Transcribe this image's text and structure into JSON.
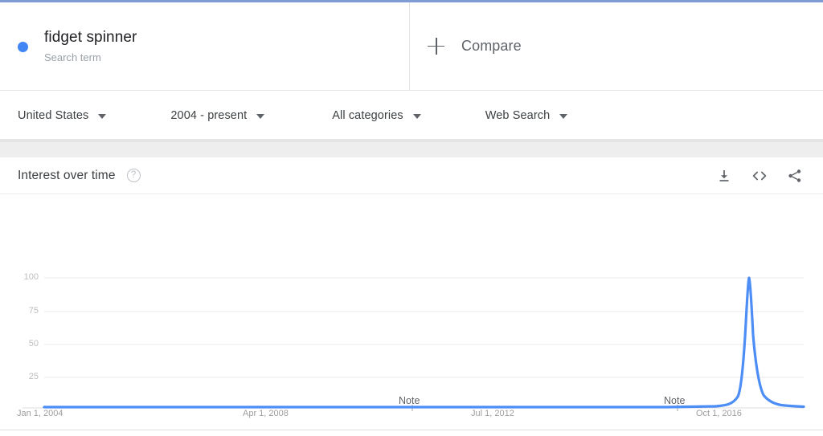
{
  "theme": {
    "accent_blue": "#4285f4",
    "top_border": "#7e9bd4",
    "line_color": "#4c8df6",
    "gridline": "#e8e8e8",
    "text_primary": "#3c4043",
    "text_muted": "#9aa0a6",
    "band_gray": "#eeeeee"
  },
  "search_term": {
    "title": "fidget spinner",
    "subtitle": "Search term"
  },
  "compare": {
    "label": "Compare",
    "icon": "plus-icon"
  },
  "filters": [
    {
      "label": "United States",
      "icon": "chevron-down-icon"
    },
    {
      "label": "2004 - present",
      "icon": "chevron-down-icon"
    },
    {
      "label": "All categories",
      "icon": "chevron-down-icon"
    },
    {
      "label": "Web Search",
      "icon": "chevron-down-icon"
    }
  ],
  "chart_card": {
    "title": "Interest over time",
    "help_glyph": "?",
    "help_icon": "help-circle-icon",
    "actions": [
      {
        "name": "download-icon",
        "label": "Download"
      },
      {
        "name": "embed-code-icon",
        "label": "Embed"
      },
      {
        "name": "share-icon",
        "label": "Share"
      }
    ]
  },
  "chart_data": {
    "type": "line",
    "title": "Interest over time",
    "xlabel": "",
    "ylabel": "",
    "ylim": [
      0,
      100
    ],
    "yticks": [
      "100",
      "75",
      "50",
      "25"
    ],
    "ytick_values": [
      100,
      75,
      50,
      25
    ],
    "grid": true,
    "legend_position": "none",
    "xtick_labels": [
      "Jan 1, 2004",
      "Apr 1, 2008",
      "Jul 1, 2012",
      "Oct 1, 2016"
    ],
    "xtick_fractions": [
      0.0,
      0.268,
      0.565,
      0.862
    ],
    "annotations": [
      {
        "label": "Note",
        "x_fraction": 0.483
      },
      {
        "label": "Note",
        "x_fraction": 0.835
      }
    ],
    "series": [
      {
        "name": "fidget spinner",
        "color": "#4c8df6",
        "x": [
          "2004-01",
          "2005-01",
          "2006-01",
          "2007-01",
          "2008-04",
          "2009-01",
          "2010-01",
          "2011-01",
          "2012-07",
          "2013-01",
          "2014-01",
          "2015-01",
          "2016-10",
          "2016-12",
          "2017-02",
          "2017-03",
          "2017-04",
          "2017-05",
          "2017-06",
          "2017-07",
          "2017-09",
          "2017-11",
          "2018-02",
          "2018-06",
          "2018-09"
        ],
        "values": [
          0,
          0,
          0,
          0,
          0,
          0,
          0,
          0,
          0,
          0,
          0,
          0,
          1,
          2,
          6,
          22,
          100,
          52,
          22,
          14,
          9,
          6,
          4,
          3,
          2
        ]
      }
    ]
  }
}
